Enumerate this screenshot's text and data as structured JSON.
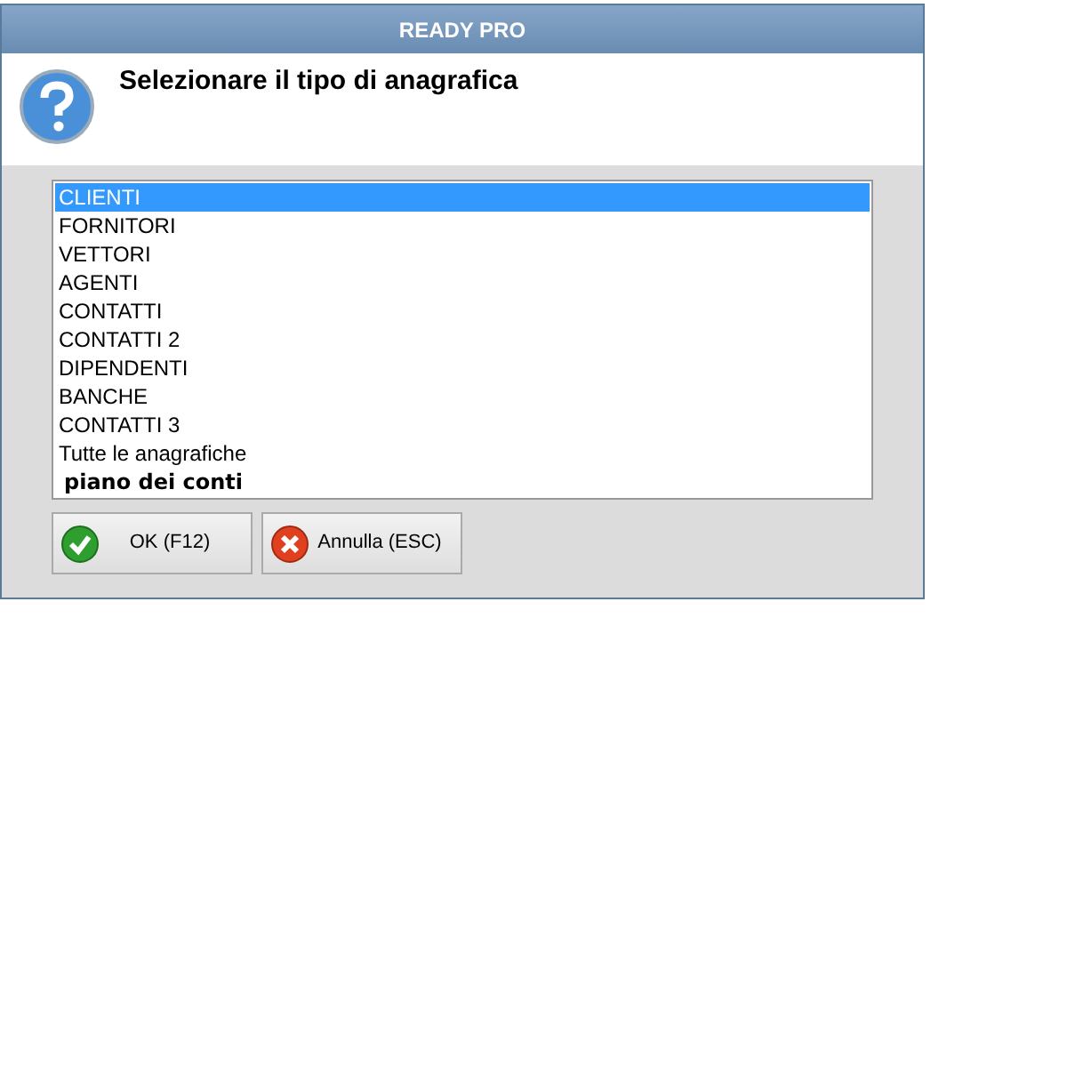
{
  "window": {
    "title": "READY PRO"
  },
  "header": {
    "text": "Selezionare il tipo di anagrafica"
  },
  "list": {
    "items": [
      {
        "label": "CLIENTI",
        "selected": true,
        "kind": "plain"
      },
      {
        "label": "FORNITORI",
        "selected": false,
        "kind": "plain"
      },
      {
        "label": "VETTORI",
        "selected": false,
        "kind": "plain"
      },
      {
        "label": "AGENTI",
        "selected": false,
        "kind": "plain"
      },
      {
        "label": "CONTATTI",
        "selected": false,
        "kind": "plain"
      },
      {
        "label": "CONTATTI 2",
        "selected": false,
        "kind": "plain"
      },
      {
        "label": "DIPENDENTI",
        "selected": false,
        "kind": "plain"
      },
      {
        "label": "BANCHE",
        "selected": false,
        "kind": "plain"
      },
      {
        "label": "CONTATTI 3",
        "selected": false,
        "kind": "plain"
      },
      {
        "label": "Tutte le anagrafiche",
        "selected": false,
        "kind": "plain"
      },
      {
        "label": "piano dei conti",
        "selected": false,
        "kind": "bold"
      }
    ]
  },
  "buttons": [
    {
      "label": "OK (F12)",
      "kind": "ok"
    },
    {
      "label": "Annulla (ESC)",
      "kind": "cancel"
    }
  ]
}
